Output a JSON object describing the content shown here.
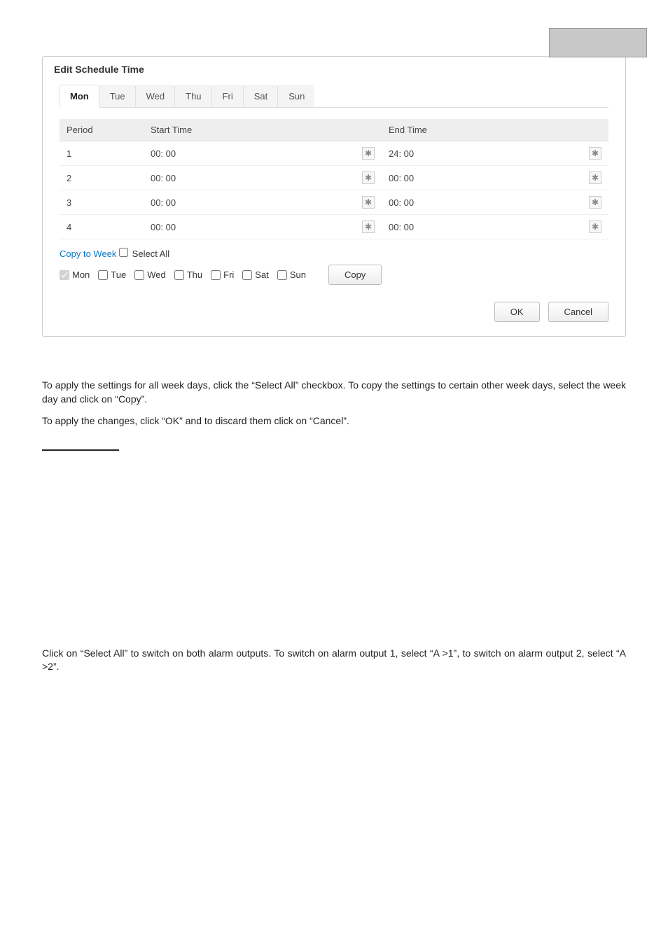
{
  "dialog": {
    "title": "Edit Schedule Time",
    "tabs": [
      "Mon",
      "Tue",
      "Wed",
      "Thu",
      "Fri",
      "Sat",
      "Sun"
    ],
    "active_tab_index": 0,
    "table": {
      "headers": {
        "period": "Period",
        "start": "Start Time",
        "end": "End Time"
      },
      "rows": [
        {
          "period": "1",
          "start": "00: 00",
          "end": "24: 00"
        },
        {
          "period": "2",
          "start": "00: 00",
          "end": "00: 00"
        },
        {
          "period": "3",
          "start": "00: 00",
          "end": "00: 00"
        },
        {
          "period": "4",
          "start": "00: 00",
          "end": "00: 00"
        }
      ]
    },
    "copy": {
      "title": "Copy to Week",
      "select_all_label": "Select All",
      "days": [
        {
          "label": "Mon",
          "checked": true,
          "disabled": true
        },
        {
          "label": "Tue",
          "checked": false,
          "disabled": false
        },
        {
          "label": "Wed",
          "checked": false,
          "disabled": false
        },
        {
          "label": "Thu",
          "checked": false,
          "disabled": false
        },
        {
          "label": "Fri",
          "checked": false,
          "disabled": false
        },
        {
          "label": "Sat",
          "checked": false,
          "disabled": false
        },
        {
          "label": "Sun",
          "checked": false,
          "disabled": false
        }
      ],
      "copy_button": "Copy"
    },
    "ok_button": "OK",
    "cancel_button": "Cancel"
  },
  "text": {
    "p1": "To apply the settings for all week days, click the “Select All” checkbox. To copy the settings to certain other week days, select the week day and click on “Copy”.",
    "p2": "To apply the changes, click “OK” and to discard them click on “Cancel”.",
    "p3": "Click on “Select All” to switch on both alarm outputs.  To switch on alarm output 1, select “A >1”, to switch on alarm output 2, select “A >2”."
  },
  "icons": {
    "clock": "✱"
  }
}
